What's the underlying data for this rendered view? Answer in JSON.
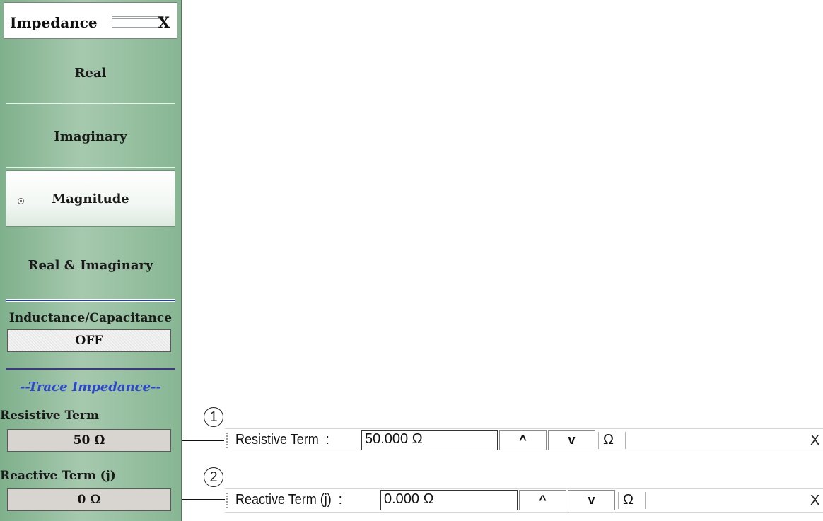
{
  "menu": {
    "title": "Impedance",
    "close": "X",
    "buttons": [
      "Real",
      "Imaginary",
      "Magnitude",
      "Real & Imaginary"
    ],
    "selected": "Magnitude",
    "inductance_label": "Inductance/Capacitance",
    "inductance_value": "OFF",
    "section_header": "--Trace Impedance--",
    "resistive_label": "Resistive Term",
    "resistive_value": "50 Ω",
    "reactive_label": "Reactive Term (j)",
    "reactive_value": "0 Ω"
  },
  "callouts": [
    "1",
    "2"
  ],
  "toolbars": [
    {
      "label": "Resistive Term  :",
      "value": "50.000  Ω",
      "up": "^",
      "down": "v",
      "unit": "Ω",
      "close": "X"
    },
    {
      "label": "Reactive Term (j)  :",
      "value": "0.000  Ω",
      "up": "^",
      "down": "v",
      "unit": "Ω",
      "close": "X"
    }
  ]
}
